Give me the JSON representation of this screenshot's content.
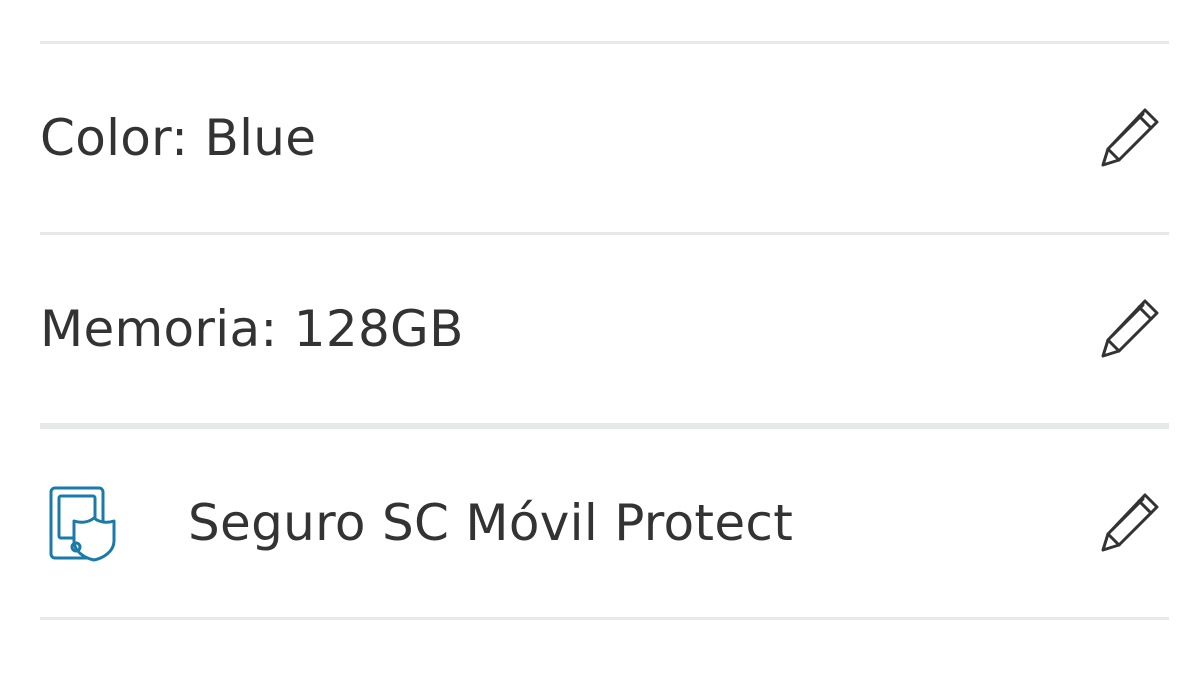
{
  "items": [
    {
      "label": "Color: Blue",
      "edit_icon": "pencil-icon"
    },
    {
      "label": "Memoria: 128GB",
      "edit_icon": "pencil-icon"
    },
    {
      "label": "Seguro SC Móvil Protect",
      "icon": "phone-shield-icon",
      "icon_color": "#1a7ba8",
      "edit_icon": "pencil-icon"
    }
  ],
  "colors": {
    "divider": "#e6e8ea",
    "text": "#333333",
    "icon_accent": "#1a7ba8"
  }
}
